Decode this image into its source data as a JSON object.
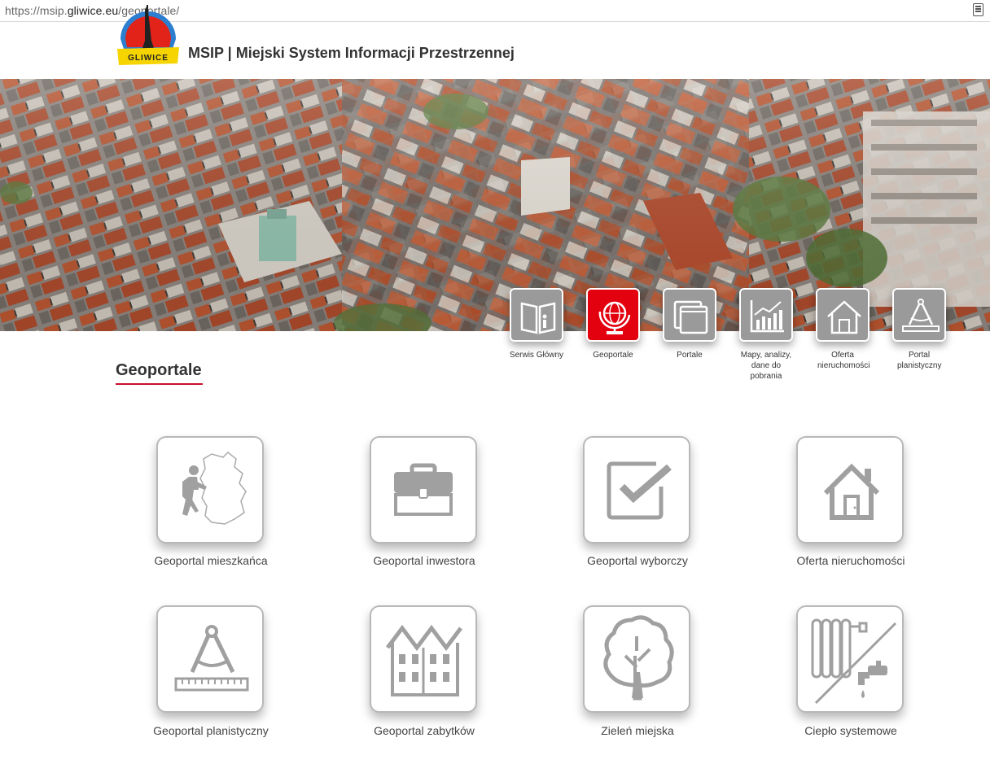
{
  "browser": {
    "url_prefix": "https://msip.",
    "url_domain": "gliwice.eu",
    "url_path": "/geoportale/",
    "reader_icon": "reader-view-icon"
  },
  "header": {
    "logo_text": "GLIWICE",
    "title": "MSIP | Miejski System Informacji Przestrzennej"
  },
  "nav": {
    "items": [
      {
        "label": "Serwis Główny",
        "icon": "info-book-icon",
        "active": false
      },
      {
        "label": "Geoportale",
        "icon": "globe-icon",
        "active": true
      },
      {
        "label": "Portale",
        "icon": "windows-icon",
        "active": false
      },
      {
        "label": "Mapy, analizy, dane do pobrania",
        "icon": "chart-icon",
        "active": false
      },
      {
        "label": "Oferta nieruchomości",
        "icon": "house-icon",
        "active": false
      },
      {
        "label": "Portal planistyczny",
        "icon": "compass-icon",
        "active": false
      }
    ],
    "accent_color": "#e3000f",
    "tile_color": "#9a9a9a"
  },
  "section": {
    "title": "Geoportale",
    "underline_color": "#c8102e"
  },
  "tiles": [
    {
      "label": "Geoportal mieszkańca",
      "icon": "resident-map-icon"
    },
    {
      "label": "Geoportal inwestora",
      "icon": "briefcase-icon"
    },
    {
      "label": "Geoportal wyborczy",
      "icon": "checkbox-icon"
    },
    {
      "label": "Oferta nieruchomości",
      "icon": "house-icon"
    },
    {
      "label": "Geoportal planistyczny",
      "icon": "compass-ruler-icon"
    },
    {
      "label": "Geoportal zabytków",
      "icon": "historic-building-icon"
    },
    {
      "label": "Zieleń miejska",
      "icon": "tree-icon"
    },
    {
      "label": "Ciepło systemowe",
      "icon": "radiator-tap-icon"
    }
  ]
}
